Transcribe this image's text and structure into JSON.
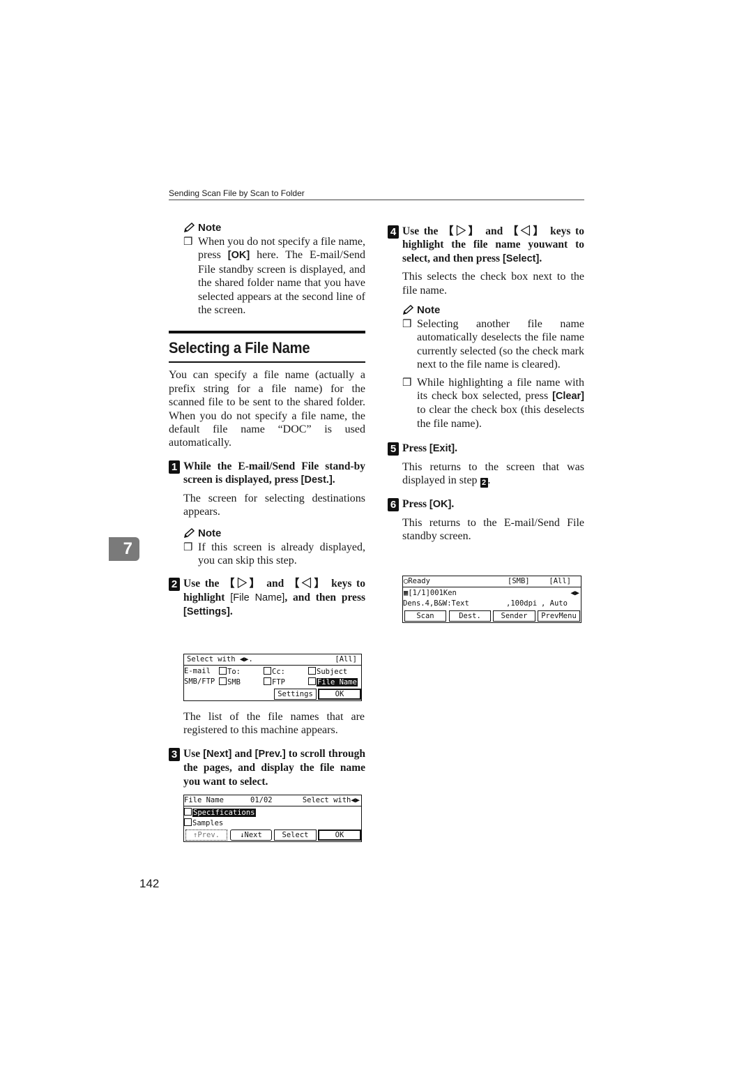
{
  "running_head": "Sending Scan File by Scan to Folder",
  "chapter_tab": "7",
  "page_number": "142",
  "left": {
    "note1": {
      "title": "Note",
      "items": [
        {
          "pre": "When you do not specify a file name, press ",
          "key": "[OK]",
          "post": " here. The E-mail/Send File standby screen is displayed, and the shared folder name that you have selected appears at the second line of the screen."
        }
      ]
    },
    "section_title": "Selecting a File Name",
    "intro": "You can specify a file name (actually a prefix string for a file name) for the scanned file to be sent to the shared folder. When you do not specify a file name, the default file name “DOC” is used automatically.",
    "step1": {
      "num": "1",
      "text": "While the E-mail/Send File stand-by screen is displayed, press ",
      "key": "[Dest.]",
      "tail": ".",
      "body": "The screen for selecting destinations appears.",
      "note_title": "Note",
      "note": "If this screen is already displayed, you can skip this step."
    },
    "step2": {
      "num": "2",
      "pre": "Use the ",
      "key_right": "【▷】",
      "mid": " and ",
      "key_left": "【◁】",
      "post": " keys to highlight ",
      "key1": "[File Name]",
      "post2": ", and then press ",
      "key2": "[Settings]",
      "tail": "."
    },
    "screen1": {
      "prompt": "Select with ◀▶.",
      "scope": "[All]",
      "row1_label": "E-mail",
      "row1": [
        "To:",
        "Cc:",
        "Subject"
      ],
      "row2_label": "SMB/FTP",
      "row2": [
        "SMB",
        "FTP",
        "File Name"
      ],
      "buttons": [
        "Settings",
        "OK"
      ]
    },
    "after_screen1": "The list of the file names that are registered to this machine appears.",
    "step3": {
      "num": "3",
      "pre": "Use ",
      "key1": "[Next]",
      "mid": " and ",
      "key2": "[Prev.]",
      "post": " to scroll through the pages, and display the file name you want to select."
    },
    "screen2": {
      "title": "File Name",
      "page": "01/02",
      "prompt": "Select with◀▶",
      "files": [
        "Specifications",
        "Samples"
      ],
      "buttons": [
        "↑Prev.",
        "↓Next",
        "Select",
        "OK"
      ]
    }
  },
  "right": {
    "step4": {
      "num": "4",
      "pre": "Use the ",
      "key_right": "【▷】",
      "mid": " and ",
      "key_left": "【◁】",
      "post": " keys to highlight the file name youwant to select, and then press ",
      "key": "[Select]",
      "tail": ".",
      "body": "This selects the check box next to the file name."
    },
    "note": {
      "title": "Note",
      "items": [
        {
          "pre": "Selecting another file name automatically deselects the file name currently selected (so the check mark next to the file name is cleared).",
          "key": "",
          "post": ""
        },
        {
          "pre": "While highlighting a file name with its check box selected, press ",
          "key": "[Clear]",
          "post": " to clear the check box (this deselects the file name)."
        }
      ]
    },
    "step5": {
      "num": "5",
      "pre": "Press ",
      "key": "[Exit]",
      "tail": ".",
      "body_pre": "This returns to the screen that was displayed in step ",
      "body_ref": "2",
      "body_post": "."
    },
    "step6": {
      "num": "6",
      "pre": "Press ",
      "key": "[OK]",
      "tail": ".",
      "body": "This returns to the E-mail/Send File standby screen."
    },
    "screen3": {
      "status": "Ready",
      "mode": "[SMB]",
      "scope": "[All]",
      "dest": "[1/1]001Ken",
      "settings": "Dens.4,B&W:Text",
      "resolution": ",100dpi",
      "size": ", Auto",
      "buttons": [
        "Scan",
        "Dest.",
        "Sender",
        "PrevMenu"
      ]
    }
  }
}
